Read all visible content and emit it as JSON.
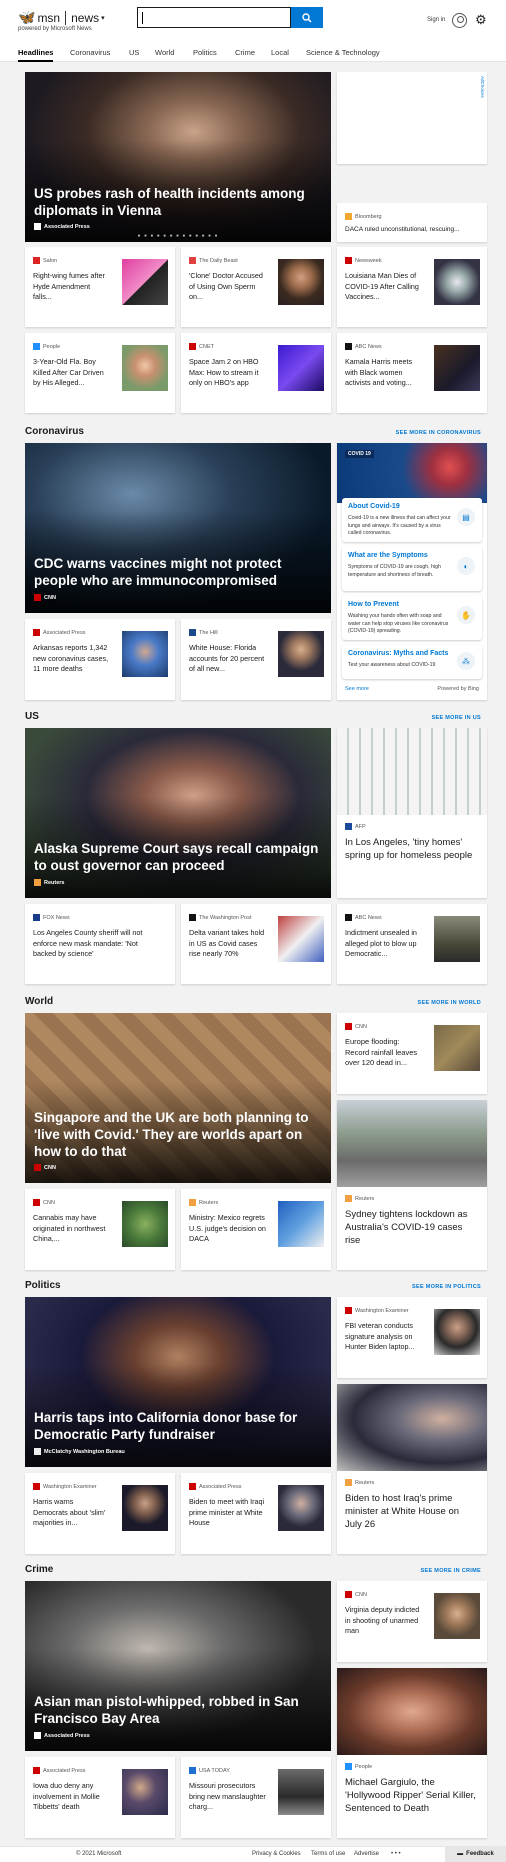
{
  "header": {
    "brand": "msn",
    "section": "news",
    "powered_by": "powered by Microsoft News",
    "search_placeholder": "",
    "sign_in": "Sign in"
  },
  "nav": [
    "Headlines",
    "Coronavirus",
    "US",
    "World",
    "Politics",
    "Crime",
    "Local",
    "Science & Technology"
  ],
  "headlines": {
    "hero": {
      "title": "US probes rash of health incidents among diplomats in Vienna",
      "source": "Associated Press"
    },
    "ad_label": "AdChoices",
    "side": {
      "source": "Bloomberg",
      "title": "DACA ruled unconstitutional, rescuing..."
    },
    "cards": [
      {
        "source": "Salon",
        "title": "Right-wing fumes after Hyde Amendment falls..."
      },
      {
        "source": "The Daily Beast",
        "title": "'Clone' Doctor Accused of Using Own Sperm on..."
      },
      {
        "source": "Newsweek",
        "title": "Louisiana Man Dies of COVID-19 After Calling Vaccines..."
      },
      {
        "source": "People",
        "title": "3-Year-Old Fla. Boy Killed After Car Driven by His Alleged..."
      },
      {
        "source": "CNET",
        "title": "Space Jam 2 on HBO Max: How to stream it only on HBO's app"
      },
      {
        "source": "ABC News",
        "title": "Kamala Harris meets with Black women activists and voting..."
      }
    ]
  },
  "coronavirus": {
    "section_title": "Coronavirus",
    "see_more": "SEE MORE IN CORONAVIRUS",
    "hero": {
      "title": "CDC warns vaccines might not protect people who are immunocompromised",
      "source": "CNN"
    },
    "cards": [
      {
        "source": "Associated Press",
        "title": "Arkansas reports 1,342 new coronavirus cases, 11 more deaths"
      },
      {
        "source": "The Hill",
        "title": "White House: Florida accounts for 20 percent of all new..."
      }
    ],
    "covid_widget": {
      "badge": "COVID 19",
      "items": [
        {
          "title": "About Covid-19",
          "desc": "Covid-19 is a new illness that can affect your lungs and airways. It's caused by a virus called coronavirus."
        },
        {
          "title": "What are the Symptoms",
          "desc": "Symptoms of COVID-19 are cough, high temperature and shortness of breath."
        },
        {
          "title": "How to Prevent",
          "desc": "Washing your hands often with soap and water can help stop viruses like coronavirus (COVID-19) spreading."
        },
        {
          "title": "Coronavirus: Myths and Facts",
          "desc": "Test your awareness about COVID-19"
        }
      ],
      "see_more": "See more",
      "powered": "Powered by Bing"
    }
  },
  "us": {
    "section_title": "US",
    "see_more": "SEE MORE IN US",
    "hero": {
      "title": "Alaska Supreme Court says recall campaign to oust governor can proceed",
      "source": "Reuters"
    },
    "side": {
      "source": "AFP",
      "title": "In Los Angeles, 'tiny homes' spring up for homeless people"
    },
    "cards": [
      {
        "source": "FOX News",
        "title": "Los Angeles County sheriff will not enforce new mask mandate: 'Not backed by science'"
      },
      {
        "source": "The Washington Post",
        "title": "Delta variant takes hold in US as Covid cases rise nearly 70%"
      },
      {
        "source": "ABC News",
        "title": "Indictment unsealed in alleged plot to blow up Democratic..."
      }
    ]
  },
  "world": {
    "section_title": "World",
    "see_more": "SEE MORE IN WORLD",
    "hero": {
      "title": "Singapore and the UK are both planning to 'live with Covid.' They are worlds apart on how to do that",
      "source": "CNN"
    },
    "side_top": {
      "source": "CNN",
      "title": "Europe flooding: Record rainfall leaves over 120 dead in..."
    },
    "side": {
      "source": "Reuters",
      "title": "Sydney tightens lockdown as Australia's COVID-19 cases rise"
    },
    "cards": [
      {
        "source": "CNN",
        "title": "Cannabis may have originated in northwest China,..."
      },
      {
        "source": "Reuters",
        "title": "Ministry: Mexico regrets U.S. judge's decision on DACA"
      }
    ]
  },
  "politics": {
    "section_title": "Politics",
    "see_more": "SEE MORE IN POLITICS",
    "hero": {
      "title": "Harris taps into California donor base for Democratic Party fundraiser",
      "source": "McClatchy Washington Bureau"
    },
    "side_top": {
      "source": "Washington Examiner",
      "title": "FBI veteran conducts signature analysis on Hunter Biden laptop..."
    },
    "side": {
      "source": "Reuters",
      "title": "Biden to host Iraq's prime minister at White House on July 26"
    },
    "cards": [
      {
        "source": "Washington Examiner",
        "title": "Harris warns Democrats about 'slim' majorities in..."
      },
      {
        "source": "Associated Press",
        "title": "Biden to meet with Iraqi prime minister at White House"
      }
    ]
  },
  "crime": {
    "section_title": "Crime",
    "see_more": "SEE MORE IN CRIME",
    "hero": {
      "title": "Asian man pistol-whipped, robbed in San Francisco Bay Area",
      "source": "Associated Press"
    },
    "side_top": {
      "source": "CNN",
      "title": "Virginia deputy indicted in shooting of unarmed man"
    },
    "side": {
      "source": "People",
      "title": "Michael Gargiulo, the 'Hollywood Ripper' Serial Killer, Sentenced to Death"
    },
    "cards": [
      {
        "source": "Associated Press",
        "title": "Iowa duo deny any involvement in Mollie Tibbetts' death"
      },
      {
        "source": "USA TODAY",
        "title": "Missouri prosecutors bring new manslaughter charg..."
      }
    ]
  },
  "footer": {
    "copyright": "© 2021 Microsoft",
    "privacy": "Privacy & Cookies",
    "terms": "Terms of use",
    "advertise": "Advertise",
    "more": "• • •",
    "feedback": "Feedback"
  },
  "colors": {
    "accent": "#0078d4",
    "search_button": "#0078d4",
    "covid_banner": "#0a4d8c"
  }
}
